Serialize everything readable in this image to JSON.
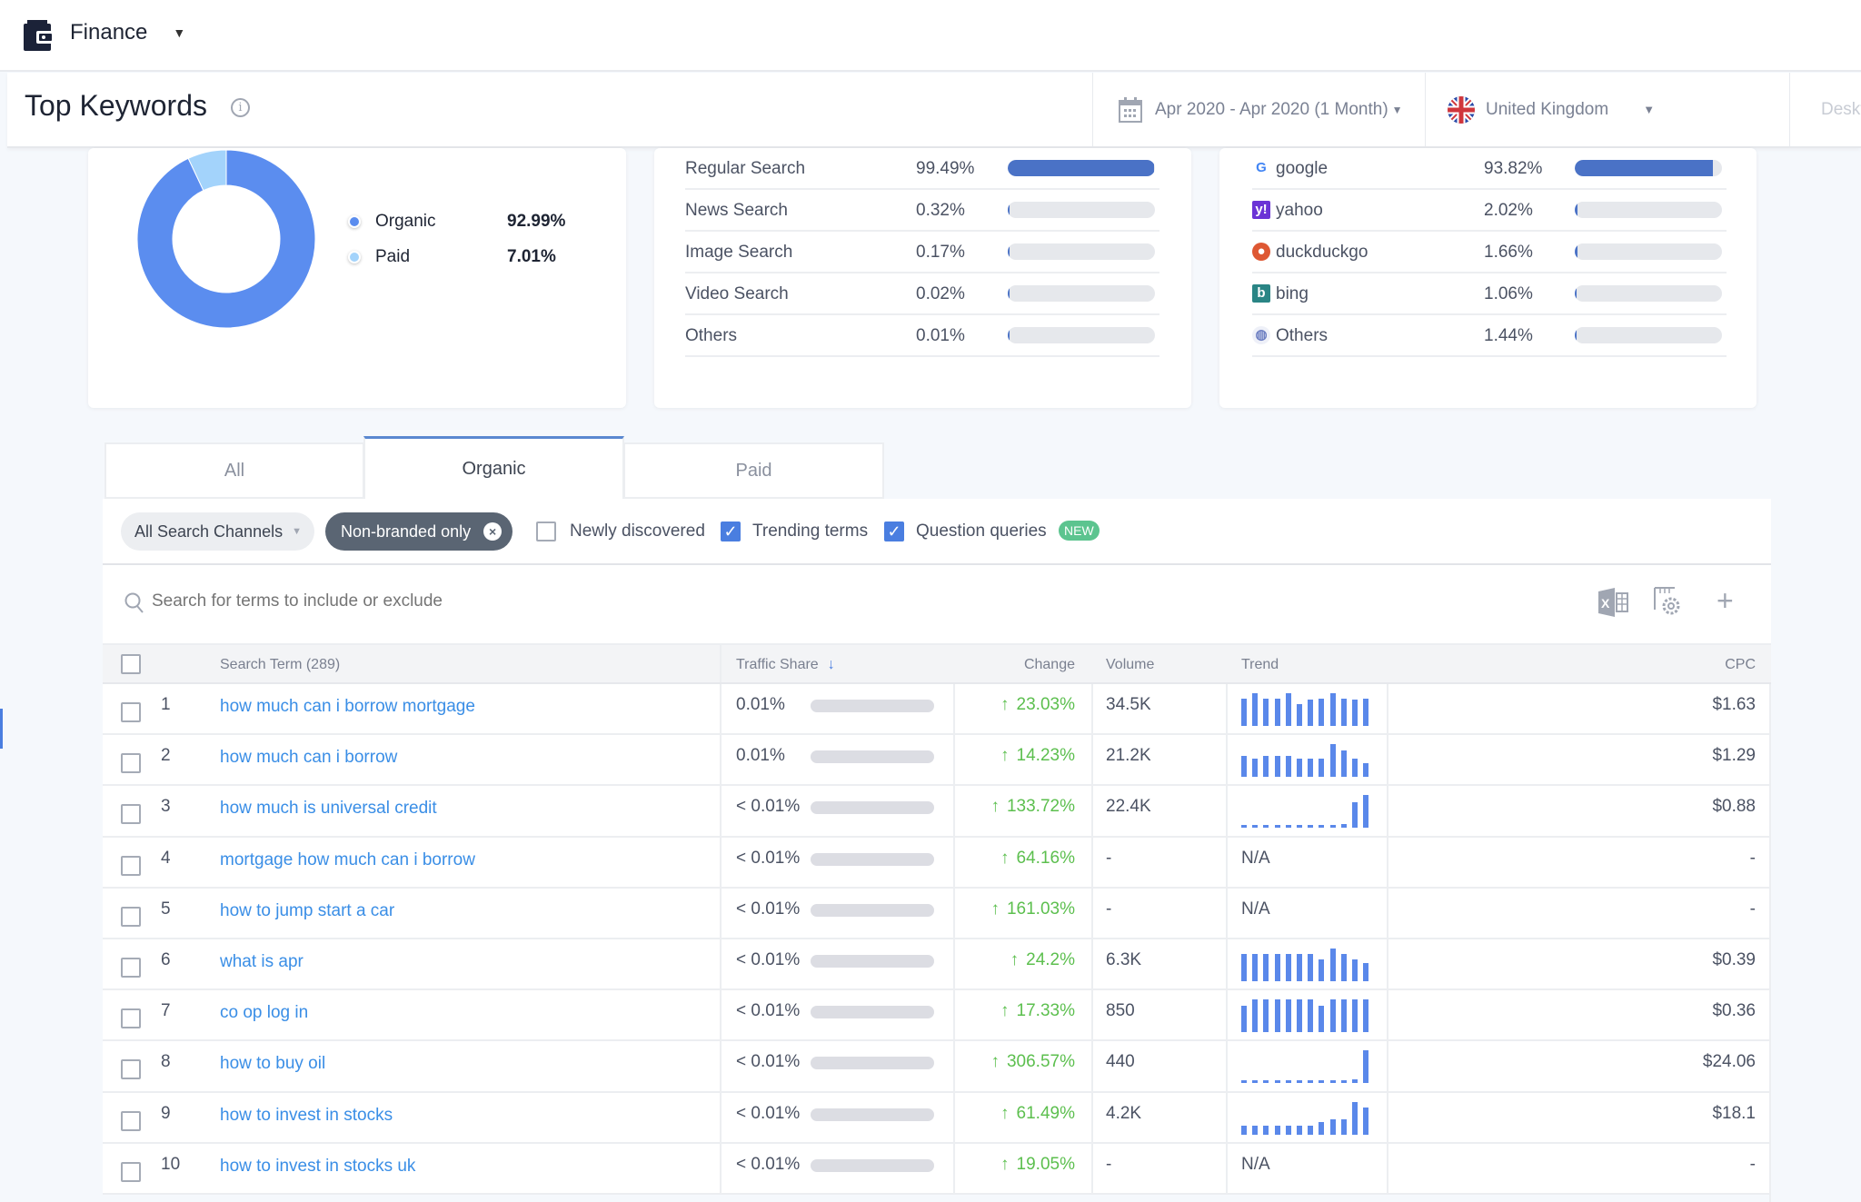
{
  "app": {
    "title": "Finance",
    "icon": "wallet-icon"
  },
  "header": {
    "title": "Top Keywords",
    "date_range": "Apr 2020 - Apr 2020 (1 Month)",
    "country": "United Kingdom",
    "device": "Desktop"
  },
  "traffic_split": {
    "items": [
      {
        "label": "Organic",
        "value": "92.99%",
        "pct": 92.99,
        "color": "#5b8def"
      },
      {
        "label": "Paid",
        "value": "7.01%",
        "pct": 7.01,
        "color": "#a3d3fb"
      }
    ]
  },
  "search_types": [
    {
      "label": "Regular Search",
      "value": "99.49%",
      "pct": 99.49
    },
    {
      "label": "News Search",
      "value": "0.32%",
      "pct": 0.32
    },
    {
      "label": "Image Search",
      "value": "0.17%",
      "pct": 0.17
    },
    {
      "label": "Video Search",
      "value": "0.02%",
      "pct": 0.02
    },
    {
      "label": "Others",
      "value": "0.01%",
      "pct": 0.01
    }
  ],
  "engines": [
    {
      "label": "google",
      "value": "93.82%",
      "pct": 93.82,
      "icon": "google-icon"
    },
    {
      "label": "yahoo",
      "value": "2.02%",
      "pct": 2.02,
      "icon": "yahoo-icon"
    },
    {
      "label": "duckduckgo",
      "value": "1.66%",
      "pct": 1.66,
      "icon": "duckduckgo-icon"
    },
    {
      "label": "bing",
      "value": "1.06%",
      "pct": 1.06,
      "icon": "bing-icon"
    },
    {
      "label": "Others",
      "value": "1.44%",
      "pct": 1.44,
      "icon": "globe-icon"
    }
  ],
  "tabs": [
    {
      "label": "All"
    },
    {
      "label": "Organic",
      "active": true
    },
    {
      "label": "Paid"
    }
  ],
  "filters": {
    "channels": "All Search Channels",
    "nonbranded": "Non-branded only",
    "newly": "Newly discovered",
    "newly_checked": false,
    "trending": "Trending terms",
    "trending_checked": true,
    "question": "Question queries",
    "question_checked": true,
    "new_badge": "NEW"
  },
  "search": {
    "placeholder": "Search for terms to include or exclude"
  },
  "table": {
    "headers": {
      "term": "Search Term (289)",
      "share": "Traffic Share",
      "change": "Change",
      "volume": "Volume",
      "trend": "Trend",
      "cpc": "CPC"
    },
    "rows": [
      {
        "n": "1",
        "term": "how much can i borrow mortgage",
        "share": "0.01%",
        "change": "23.03%",
        "volume": "34.5K",
        "trend": [
          0.82,
          1,
          0.82,
          0.82,
          1,
          0.68,
          0.8,
          0.82,
          1,
          0.82,
          0.8,
          0.82
        ],
        "cpc": "$1.63"
      },
      {
        "n": "2",
        "term": "how much can i borrow",
        "share": "0.01%",
        "change": "14.23%",
        "volume": "21.2K",
        "trend": [
          0.65,
          0.55,
          0.65,
          0.65,
          0.65,
          0.55,
          0.55,
          0.55,
          1,
          0.8,
          0.55,
          0.42
        ],
        "cpc": "$1.29"
      },
      {
        "n": "3",
        "term": "how much is universal credit",
        "share": "< 0.01%",
        "change": "133.72%",
        "volume": "22.4K",
        "trend": [
          0.08,
          0.08,
          0.08,
          0.1,
          0.08,
          0.08,
          0.08,
          0.08,
          0.1,
          0.12,
          0.8,
          1
        ],
        "cpc": "$0.88"
      },
      {
        "n": "4",
        "term": "mortgage how much can i borrow",
        "share": "< 0.01%",
        "change": "64.16%",
        "volume": "-",
        "trend": null,
        "cpc": "-"
      },
      {
        "n": "5",
        "term": "how to jump start a car",
        "share": "< 0.01%",
        "change": "161.03%",
        "volume": "-",
        "trend": null,
        "cpc": "-"
      },
      {
        "n": "6",
        "term": "what is apr",
        "share": "< 0.01%",
        "change": "24.2%",
        "volume": "6.3K",
        "trend": [
          0.82,
          0.82,
          0.82,
          0.82,
          0.82,
          0.82,
          0.82,
          0.68,
          1,
          0.82,
          0.68,
          0.55
        ],
        "cpc": "$0.39"
      },
      {
        "n": "7",
        "term": "co op log in",
        "share": "< 0.01%",
        "change": "17.33%",
        "volume": "850",
        "trend": [
          0.8,
          1,
          1,
          1,
          1,
          1,
          1,
          0.8,
          1,
          1,
          1,
          1
        ],
        "cpc": "$0.36"
      },
      {
        "n": "8",
        "term": "how to buy oil",
        "share": "< 0.01%",
        "change": "306.57%",
        "volume": "440",
        "trend": [
          0.03,
          0.03,
          0.03,
          0.03,
          0.03,
          0.03,
          0.03,
          0.03,
          0.03,
          0.03,
          0.12,
          1
        ],
        "cpc": "$24.06"
      },
      {
        "n": "9",
        "term": "how to invest in stocks",
        "share": "< 0.01%",
        "change": "61.49%",
        "volume": "4.2K",
        "trend": [
          0.26,
          0.26,
          0.26,
          0.26,
          0.26,
          0.26,
          0.26,
          0.37,
          0.47,
          0.47,
          1,
          0.82
        ],
        "cpc": "$18.1"
      },
      {
        "n": "10",
        "term": "how to invest in stocks uk",
        "share": "< 0.01%",
        "change": "19.05%",
        "volume": "-",
        "trend": null,
        "cpc": "-"
      }
    ],
    "na_label": "N/A"
  },
  "colors": {
    "accent": "#4a72c6",
    "link": "#3a8ee6",
    "positive": "#5cbf4e",
    "badge": "#5cc48f",
    "chip_dark": "#5a6573"
  }
}
